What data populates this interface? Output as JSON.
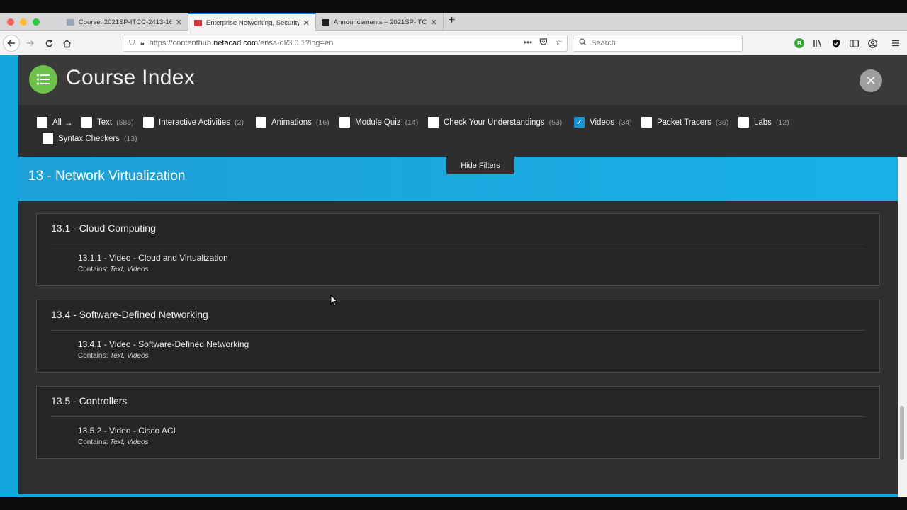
{
  "browser": {
    "tabs": [
      {
        "label": "Course: 2021SP-ITCC-2413-16",
        "active": false
      },
      {
        "label": "Enterprise Networking, Security",
        "active": true
      },
      {
        "label": "Announcements – 2021SP-ITCC",
        "active": false
      }
    ],
    "new_tab": "+",
    "url_prefix": "https://contenthub.",
    "url_domain": "netacad.com",
    "url_path": "/ensa-dl/3.0.1?lng=en",
    "url_menu": "•••",
    "search_placeholder": "Search",
    "addon_badge": "B"
  },
  "page": {
    "title": "Course Index",
    "close_label": "✕",
    "hide_filters": "Hide Filters",
    "filters": [
      {
        "label": "All",
        "count": "",
        "checked": false,
        "arrow": "→"
      },
      {
        "label": "Text",
        "count": "(586)",
        "checked": false
      },
      {
        "label": "Interactive Activities",
        "count": "(2)",
        "checked": false
      },
      {
        "label": "Animations",
        "count": "(16)",
        "checked": false
      },
      {
        "label": "Module Quiz",
        "count": "(14)",
        "checked": false
      },
      {
        "label": "Check Your Understandings",
        "count": "(53)",
        "checked": false
      },
      {
        "label": "Videos",
        "count": "(34)",
        "checked": true
      },
      {
        "label": "Packet Tracers",
        "count": "(36)",
        "checked": false
      },
      {
        "label": "Labs",
        "count": "(12)",
        "checked": false
      },
      {
        "label": "Syntax Checkers",
        "count": "(13)",
        "checked": false
      }
    ],
    "module_title": "13 - Network Virtualization",
    "contains_label": "Contains:",
    "sections": [
      {
        "title": "13.1 - Cloud Computing",
        "item": "13.1.1 - Video - Cloud and Virtualization",
        "contains": "Text, Videos"
      },
      {
        "title": "13.4 - Software-Defined Networking",
        "item": "13.4.1 - Video - Software-Defined Networking",
        "contains": "Text, Videos"
      },
      {
        "title": "13.5 - Controllers",
        "item": "13.5.2 - Video - Cisco ACI",
        "contains": "Text, Videos"
      }
    ]
  },
  "colors": {
    "accent_blue": "#14a7df",
    "logo_green": "#6cc24a",
    "checked_blue": "#1893d4",
    "header_bg": "#3a3a3a",
    "content_bg": "#2f2f2f"
  }
}
